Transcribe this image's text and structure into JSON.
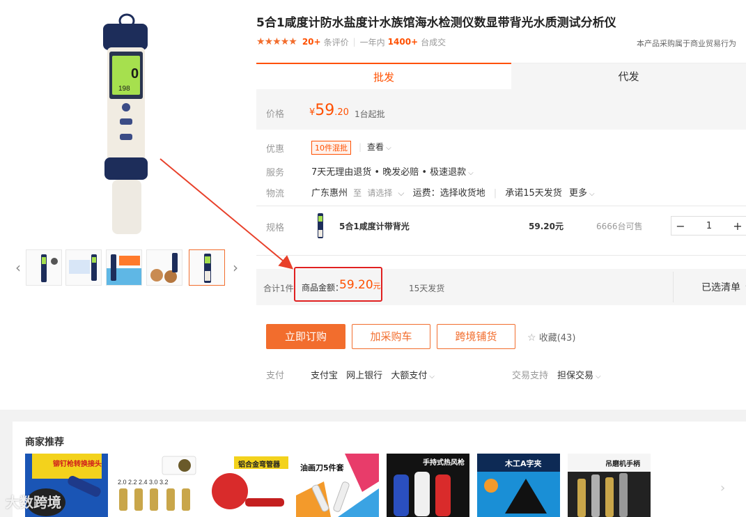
{
  "product": {
    "title": "5合1咸度计防水盐度计水族馆海水检测仪数显带背光水质测试分析仪",
    "review_count": "20+",
    "review_label": "条评价",
    "year_label": "一年内",
    "deal_count": "1400+",
    "deal_unit": "台成交",
    "trade_note": "本产品采购属于商业贸易行为",
    "rating_stars": 5
  },
  "tabs": [
    {
      "label": "批发",
      "active": true
    },
    {
      "label": "代发",
      "active": false
    }
  ],
  "price": {
    "label": "价格",
    "currency": "¥",
    "integer": "59",
    "decimal": ".20",
    "moq": "1台起批"
  },
  "promo": {
    "label": "优惠",
    "tag": "10件混批",
    "view": "查看"
  },
  "service": {
    "label": "服务",
    "text": "7天无理由退货 • 晚发必赔 • 极速退款"
  },
  "logistics": {
    "label": "物流",
    "origin": "广东惠州",
    "to": "至",
    "select": "请选择",
    "freight": "运费：选择收货地",
    "promise": "承诺15天发货",
    "more": "更多"
  },
  "spec": {
    "label": "规格",
    "name": "5合1咸度计带背光",
    "price": "59.20元",
    "stock": "6666台可售",
    "quantity": "1",
    "minus": "−",
    "plus": "+"
  },
  "summary": {
    "count": "合计1件",
    "amount_label": "商品金额：",
    "amount": "59.20",
    "amount_unit": "元",
    "ship": "15天发货",
    "list_toggle": "已选清单"
  },
  "actions": {
    "buy": "立即订购",
    "cart": "加采购车",
    "cross": "跨境铺货",
    "favorite": "收藏(43)"
  },
  "payment": {
    "label": "支付",
    "methods": [
      "支付宝",
      "网上银行",
      "大额支付"
    ],
    "trade_label": "交易支持",
    "trade_value": "担保交易"
  },
  "recommend": {
    "title": "商家推荐",
    "cards": [
      {
        "caption": "铆钉枪转换接头",
        "bg": "#1a55b5"
      },
      {
        "caption": "",
        "bg": "#ffffff"
      },
      {
        "caption": "铝合金弯管器",
        "bg": "#d92b2b"
      },
      {
        "caption": "油画刀5件套",
        "bg": "#ffffff"
      },
      {
        "caption": "手持式热风枪",
        "bg": "#121212"
      },
      {
        "caption": "木工A字夹",
        "bg": "#1a8fd6"
      },
      {
        "caption": "吊磨机手柄",
        "bg": "#222222"
      }
    ],
    "watermark": "大数跨境"
  },
  "colors": {
    "accent": "#ff5000",
    "button": "#f26d2d",
    "highlight": "#e02020"
  }
}
